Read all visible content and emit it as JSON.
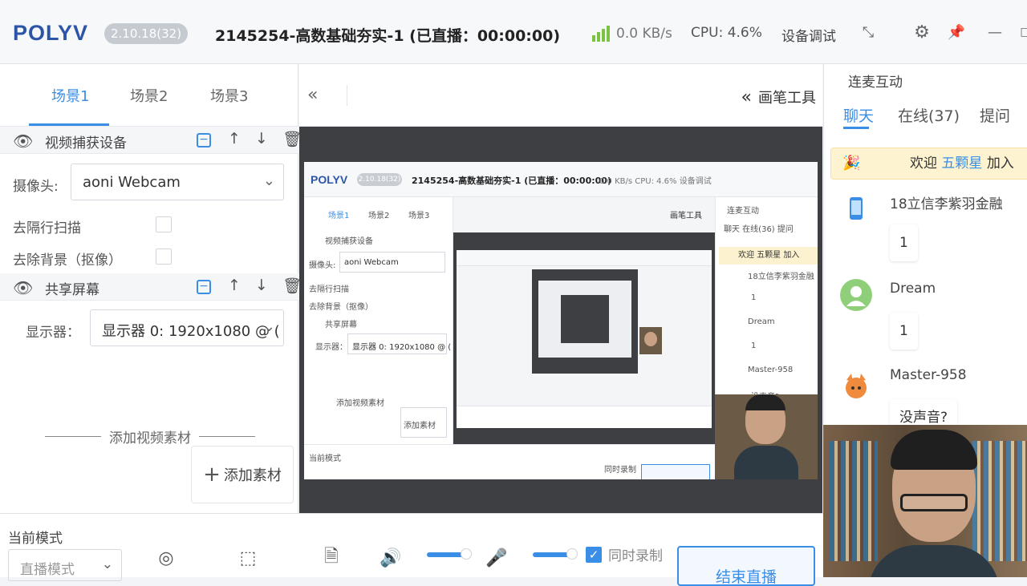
{
  "titlebar": {
    "logo": "POLYV",
    "version": "2.10.18(32)",
    "title": "2145254-高数基础夯实-1    (已直播：00:00:00)",
    "network": "0.0 KB/s",
    "cpu": "CPU: 4.6%",
    "device_test": "设备调试",
    "icons": [
      "signal-icon",
      "collapse-icon",
      "gear-icon",
      "pin-icon",
      "minimize-icon"
    ]
  },
  "scenes": {
    "tabs": [
      "场景1",
      "场景2",
      "场景3"
    ],
    "active": 0
  },
  "sources": [
    {
      "name": "视频捕获设备",
      "camera_label": "摄像头:",
      "camera_value": "aoni Webcam",
      "option1": "去隔行扫描",
      "option2": "去除背景（抠像）"
    },
    {
      "name": "共享屏幕",
      "display_label": "显示器：",
      "display_value": "显示器 0: 1920x1080 @ ("
    }
  ],
  "add_source": {
    "label": "添加视频素材",
    "button": "添加素材"
  },
  "center": {
    "pen_tools": "画笔工具"
  },
  "preview": {
    "logo": "POLYV",
    "version": "2.10.18(32)",
    "title": "2145254-高数基础夯实-1    (已直播：00:00:00)",
    "status": "0.0 KB/s    CPU: 4.6%    设备调试",
    "tabs": [
      "场景1",
      "场景2",
      "场景3"
    ],
    "src1": "视频捕获设备",
    "cam_label": "摄像头:",
    "cam_value": "aoni Webcam",
    "opt1": "去隔行扫描",
    "opt2": "去除背景（抠像）",
    "src2": "共享屏幕",
    "display_label": "显示器：",
    "display_value": "显示器 0: 1920x1080 @ (",
    "add_label": "添加视频素材",
    "add_btn": "添加素材",
    "pen": "画笔工具",
    "chat_header": "连麦互动",
    "chat_tabs": "聊天    在线(36)    提问",
    "welcome": "欢迎 五颗星 加入",
    "m1": "18立信李紫羽金融",
    "m2": "Dream",
    "m3": "Master-958",
    "m3_text": "没声音?",
    "one": "1",
    "mode": "当前模式",
    "sync": "同时录制"
  },
  "chat": {
    "header": "连麦互动",
    "tabs": [
      "聊天",
      "在线(37)",
      "提问"
    ],
    "welcome_prefix": "欢迎",
    "welcome_name": "五颗星",
    "welcome_suffix": "加入",
    "messages": [
      {
        "name": "18立信李紫羽金融",
        "text": "1",
        "avatar": "phone-avatar-icon"
      },
      {
        "name": "Dream",
        "text": "1",
        "avatar": "user-avatar-icon"
      },
      {
        "name": "Master-958",
        "text": "没声音?",
        "avatar": "fox-avatar-icon"
      }
    ]
  },
  "bottom": {
    "mode_label": "当前模式",
    "mode_value": "直播模式",
    "sync_record": "同时录制",
    "end_live": "结束直播",
    "icons": [
      "camera-icon",
      "screen-select-icon",
      "document-icon",
      "speaker-icon",
      "microphone-icon"
    ],
    "speaker_level": 0.9,
    "mic_level": 0.9
  },
  "colors": {
    "accent": "#3a8ee6",
    "logo": "#2c55a8",
    "signal": "#7cc243",
    "welcome_bg": "#fdf3d0"
  }
}
